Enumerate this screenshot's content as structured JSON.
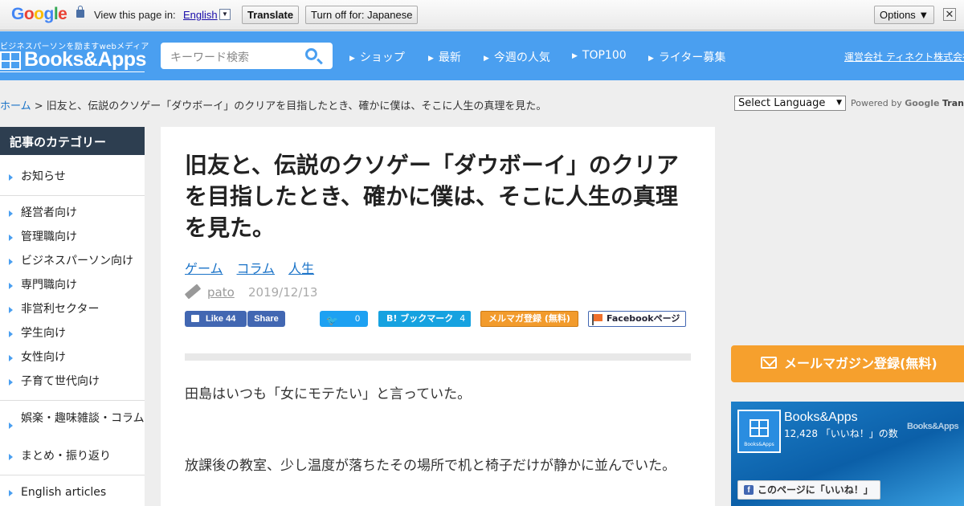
{
  "google_bar": {
    "logo": "Google",
    "view_text": "View this page in:",
    "language": "English",
    "language_caret": "▼",
    "translate_label": "Translate",
    "turnoff_label": "Turn off for: Japanese",
    "options_label": "Options ▼",
    "close_label": "✕"
  },
  "header": {
    "tagline": "ビジネスパーソンを励ますwebメディア",
    "logo_text": "Books&Apps",
    "search_placeholder": "キーワード検索",
    "nav": [
      {
        "label": "ショップ"
      },
      {
        "label": "最新"
      },
      {
        "label": "今週の人気"
      },
      {
        "label": "TOP100"
      },
      {
        "label": "ライター募集"
      }
    ],
    "nav_caret": "▶",
    "company_link": "運営会社 ティネクト株式会社"
  },
  "breadcrumb": {
    "home": "ホーム",
    "separator": " > ",
    "current": "旧友と、伝説のクソゲー「ダウボーイ」のクリアを目指したとき、確かに僕は、そこに人生の真理を見た。"
  },
  "translate_widget": {
    "select_label": "Select Language",
    "select_arrow": "▼",
    "powered_by": "Powered by",
    "google": "Google",
    "translate": "Translate"
  },
  "sidebar": {
    "heading": "記事のカテゴリー",
    "items": [
      {
        "label": "お知らせ"
      },
      {
        "label": "経営者向け"
      },
      {
        "label": "管理職向け"
      },
      {
        "label": "ビジネスパーソン向け"
      },
      {
        "label": "専門職向け"
      },
      {
        "label": "非営利セクター"
      },
      {
        "label": "学生向け"
      },
      {
        "label": "女性向け"
      },
      {
        "label": "子育て世代向け"
      },
      {
        "label": "娯楽・趣味雑談・コラム"
      },
      {
        "label": "まとめ・振り返り"
      },
      {
        "label": "English articles"
      }
    ]
  },
  "article": {
    "title": "旧友と、伝説のクソゲー「ダウボーイ」のクリアを目指したとき、確かに僕は、そこに人生の真理を見た。",
    "tags": [
      "ゲーム",
      "コラム",
      "人生"
    ],
    "author": "pato",
    "date": "2019/12/13",
    "share": {
      "fb_like_label": "Like",
      "fb_like_count": "44",
      "fb_share_label": "Share",
      "twitter_glyph": "🐦",
      "twitter_count": "0",
      "hatena_label": "B! ブックマーク",
      "hatena_count": "4",
      "mail_label": "メルマガ登録 (無料)",
      "fbpage_label": "Facebookページ"
    },
    "paragraphs": [
      "田島はいつも「女にモテたい」と言っていた。",
      "放課後の教室、少し温度が落ちたその場所で机と椅子だけが静かに並んでいた。"
    ]
  },
  "right": {
    "magazine_label": "メールマガジン登録(無料)",
    "fb_widget": {
      "logo_small": "Books&Apps",
      "name": "Books&Apps",
      "likes": "12,428 「いいね！」の数",
      "brand": "Books&Apps",
      "like_button": "このページに「いいね！」",
      "fb_glyph": "f"
    }
  },
  "colors": {
    "header_blue": "#4a9ff0",
    "sidebar_heading": "#2d3e50",
    "link_blue": "#1a73c8",
    "magazine_orange": "#f6a02d",
    "facebook_blue": "#4267b2",
    "twitter_blue": "#1da1f2"
  }
}
